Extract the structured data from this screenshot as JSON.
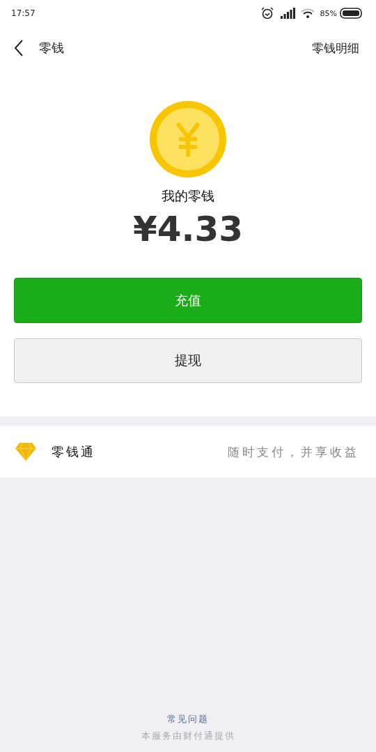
{
  "status_bar": {
    "time": "17:57",
    "battery": "85%"
  },
  "nav": {
    "title": "零钱",
    "action": "零钱明细"
  },
  "balance": {
    "label": "我的零钱",
    "amount": "¥4.33"
  },
  "buttons": [
    {
      "label": "充值",
      "kind": "primary"
    },
    {
      "label": "提现",
      "kind": "secondary"
    }
  ],
  "service": {
    "name": "零钱通",
    "tagline": "随时支付，并享收益"
  },
  "footer": {
    "link": "常见问题",
    "note": "本服务由财付通提供"
  }
}
